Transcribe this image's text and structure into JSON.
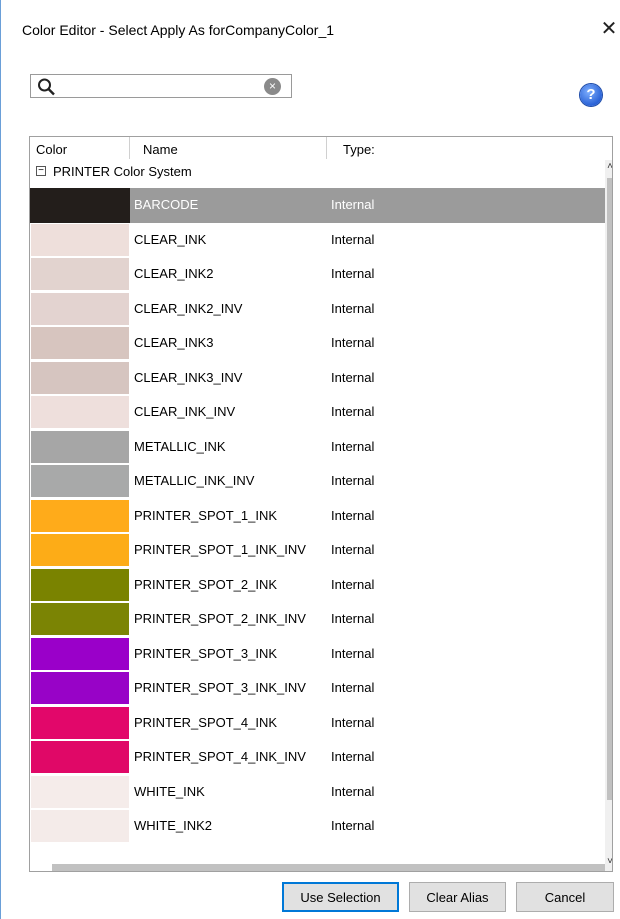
{
  "window": {
    "title": "Color Editor - Select Apply As forCompanyColor_1",
    "close_glyph": "✕"
  },
  "search": {
    "value": "",
    "placeholder": "",
    "search_icon": "search-icon",
    "clear_icon": "clear-icon",
    "clear_glyph": "×"
  },
  "help": {
    "glyph": "?"
  },
  "table": {
    "headers": {
      "color": "Color",
      "name": "Name",
      "type": "Type:"
    },
    "group": {
      "collapse_glyph": "−",
      "label": "PRINTER Color System"
    },
    "rows": [
      {
        "color": "#231e1b",
        "name": "BARCODE",
        "type": "Internal",
        "selected": true
      },
      {
        "color": "#eedfdb",
        "name": "CLEAR_INK",
        "type": "Internal"
      },
      {
        "color": "#e2d3cf",
        "name": "CLEAR_INK2",
        "type": "Internal"
      },
      {
        "color": "#e3d3d0",
        "name": "CLEAR_INK2_INV",
        "type": "Internal"
      },
      {
        "color": "#d7c5bf",
        "name": "CLEAR_INK3",
        "type": "Internal"
      },
      {
        "color": "#d6c5c0",
        "name": "CLEAR_INK3_INV",
        "type": "Internal"
      },
      {
        "color": "#eedfdc",
        "name": "CLEAR_INK_INV",
        "type": "Internal"
      },
      {
        "color": "#a6a6a6",
        "name": "METALLIC_INK",
        "type": "Internal"
      },
      {
        "color": "#a8a9a9",
        "name": "METALLIC_INK_INV",
        "type": "Internal"
      },
      {
        "color": "#ffab1a",
        "name": "PRINTER_SPOT_1_INK",
        "type": "Internal"
      },
      {
        "color": "#fdac17",
        "name": "PRINTER_SPOT_1_INK_INV",
        "type": "Internal"
      },
      {
        "color": "#7a8300",
        "name": "PRINTER_SPOT_2_INK",
        "type": "Internal"
      },
      {
        "color": "#7b8404",
        "name": "PRINTER_SPOT_2_INK_INV",
        "type": "Internal"
      },
      {
        "color": "#9a00c9",
        "name": "PRINTER_SPOT_3_INK",
        "type": "Internal"
      },
      {
        "color": "#9803c7",
        "name": "PRINTER_SPOT_3_INK_INV",
        "type": "Internal"
      },
      {
        "color": "#e2076a",
        "name": "PRINTER_SPOT_4_INK",
        "type": "Internal"
      },
      {
        "color": "#e00867",
        "name": "PRINTER_SPOT_4_INK_INV",
        "type": "Internal"
      },
      {
        "color": "#f5ecea",
        "name": "WHITE_INK",
        "type": "Internal"
      },
      {
        "color": "#f4ebe9",
        "name": "WHITE_INK2",
        "type": "Internal"
      }
    ]
  },
  "buttons": {
    "use_selection": "Use Selection",
    "clear_alias": "Clear Alias",
    "cancel": "Cancel"
  }
}
